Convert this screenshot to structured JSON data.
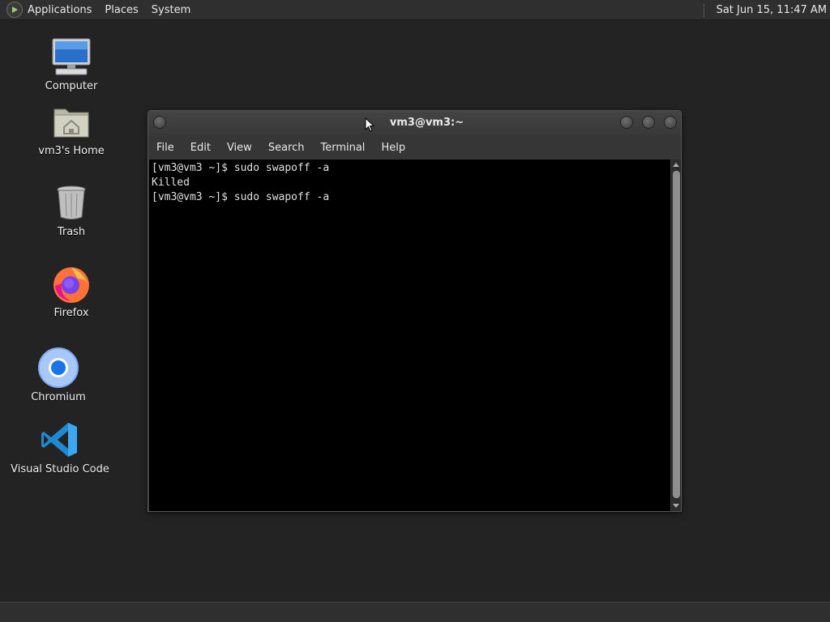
{
  "top_panel": {
    "menus": [
      "Applications",
      "Places",
      "System"
    ],
    "clock": "Sat Jun 15, 11:47 AM"
  },
  "desktop_icons": [
    {
      "label": "Computer",
      "icon": "computer-icon"
    },
    {
      "label": "vm3's Home",
      "icon": "home-folder-icon"
    },
    {
      "label": "Trash",
      "icon": "trash-icon"
    },
    {
      "label": "Firefox",
      "icon": "firefox-icon"
    },
    {
      "label": "Chromium",
      "icon": "chromium-icon"
    },
    {
      "label": "Visual Studio Code",
      "icon": "vscode-icon"
    }
  ],
  "terminal": {
    "title": "vm3@vm3:~",
    "menu": [
      "File",
      "Edit",
      "View",
      "Search",
      "Terminal",
      "Help"
    ],
    "lines": [
      "[vm3@vm3 ~]$ sudo swapoff -a",
      "Killed",
      "[vm3@vm3 ~]$ sudo swapoff -a"
    ]
  },
  "colors": {
    "desktop_bg": "#232323",
    "panel_bg": "#2f2f2f",
    "terminal_bg": "#000000",
    "terminal_fg": "#e0e0e0"
  }
}
